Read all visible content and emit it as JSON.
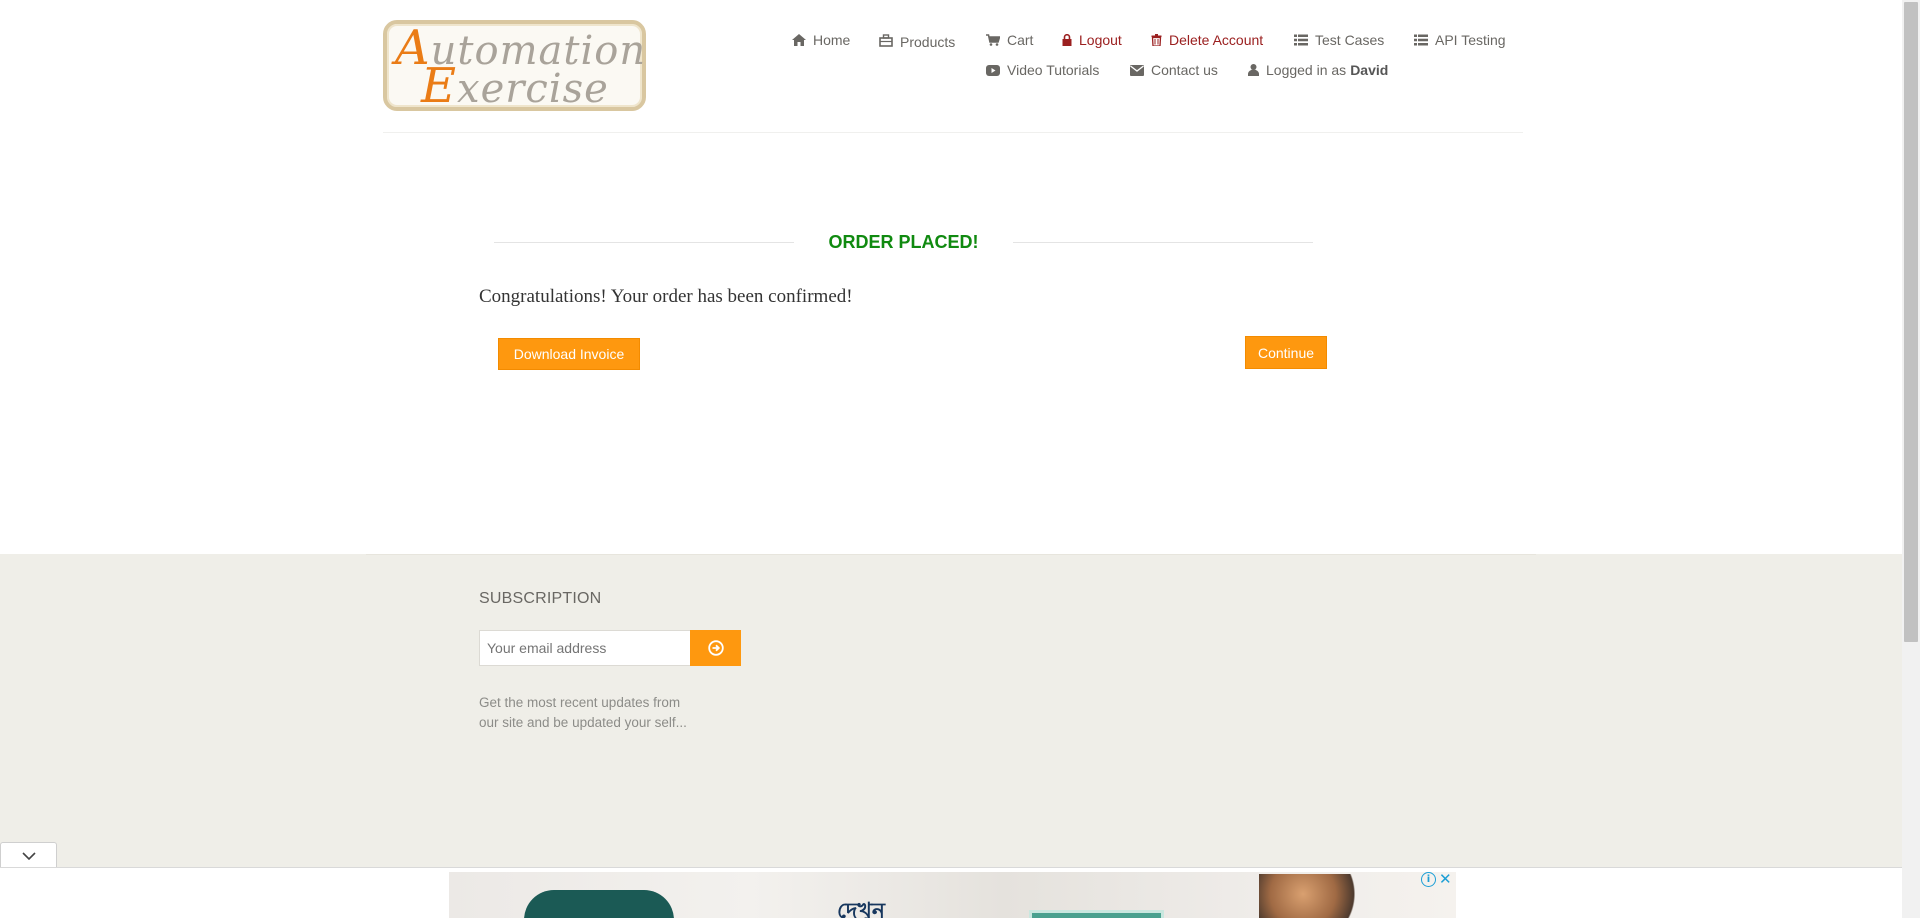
{
  "logo": {
    "line1_cap": "A",
    "line1_rest": "utomation",
    "line2_cap": "E",
    "line2_rest": "xercise"
  },
  "nav": {
    "home": "Home",
    "products": "Products",
    "cart": "Cart",
    "logout": "Logout",
    "delete_account": "Delete Account",
    "test_cases": "Test Cases",
    "api_testing": "API Testing",
    "video_tutorials": "Video Tutorials",
    "contact_us": "Contact us",
    "logged_in_prefix": "Logged in as",
    "logged_in_user": "David"
  },
  "order": {
    "title": "ORDER PLACED!",
    "message": "Congratulations! Your order has been confirmed!",
    "download_invoice_label": "Download Invoice",
    "continue_label": "Continue"
  },
  "footer": {
    "subscription_title": "SUBSCRIPTION",
    "email_placeholder": "Your email address",
    "subscription_text": "Get the most recent updates from our site and be updated your self..."
  },
  "ad": {
    "banner_text": "দেখুন",
    "info_label": "i",
    "close_label": "✕"
  },
  "colors": {
    "accent_orange": "#fe980f",
    "success_green": "#108a10",
    "danger_red": "#9b2020",
    "footer_bg": "#efeee8"
  }
}
